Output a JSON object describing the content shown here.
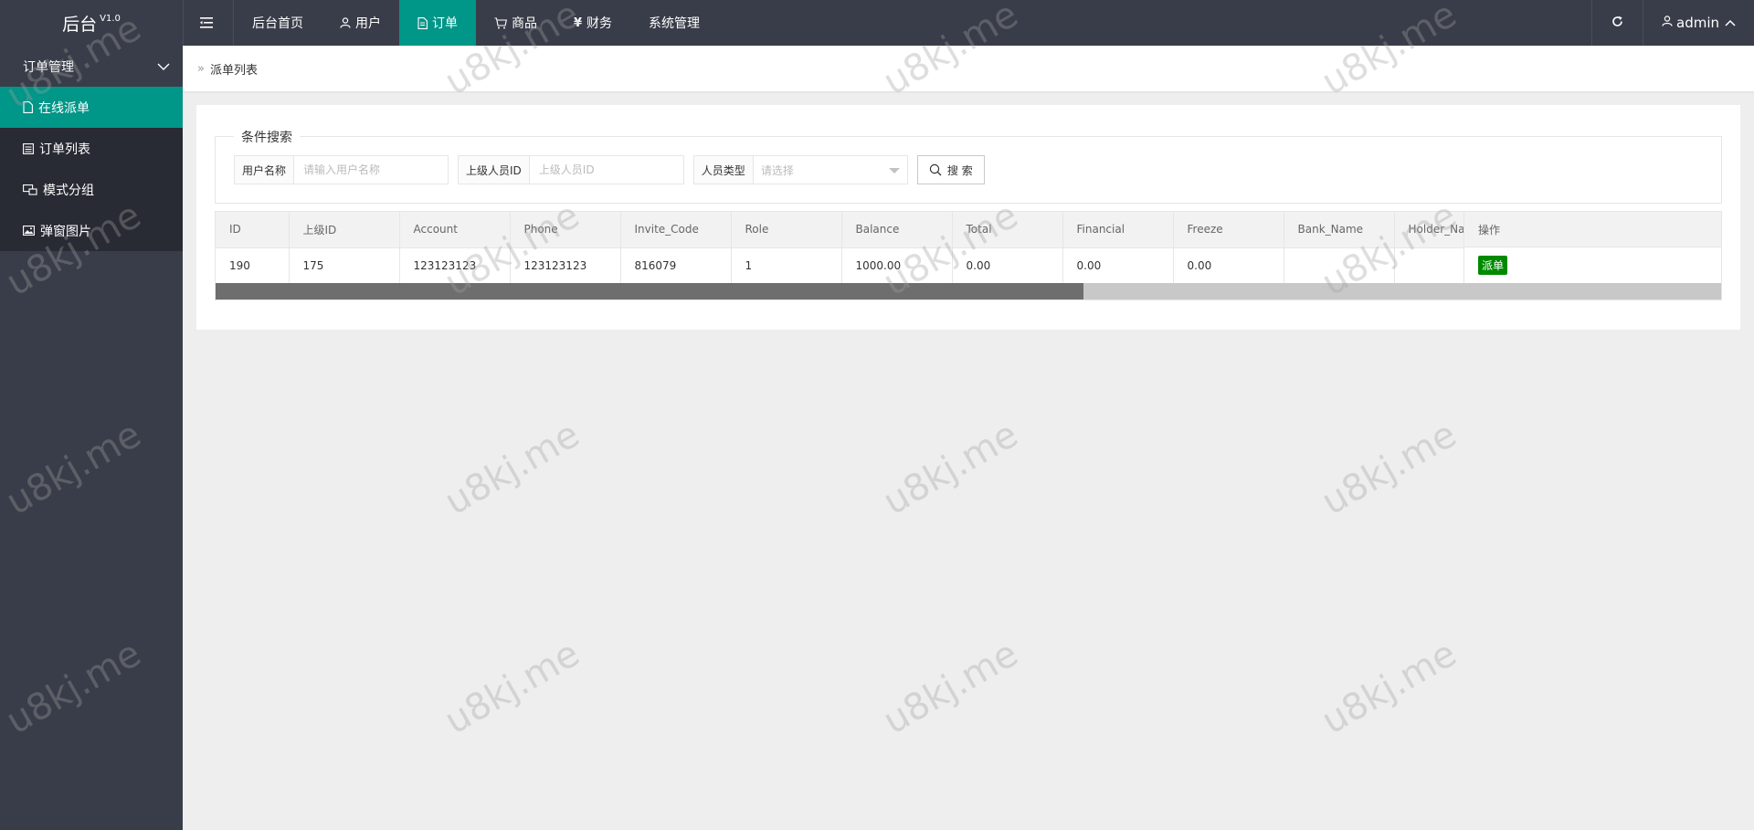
{
  "app": {
    "title": "后台",
    "version": "V1.0"
  },
  "topnav": {
    "items": [
      {
        "label": "后台首页",
        "icon": ""
      },
      {
        "label": "用户",
        "icon": "user-icon"
      },
      {
        "label": "订单",
        "icon": "document-icon",
        "active": true
      },
      {
        "label": "商品",
        "icon": "cart-icon"
      },
      {
        "label": "财务",
        "icon": "yen-icon"
      },
      {
        "label": "系统管理",
        "icon": ""
      }
    ],
    "user": "admin"
  },
  "sidebar": {
    "group": "订单管理",
    "items": [
      {
        "label": "在线派单",
        "icon": "document-icon",
        "active": true
      },
      {
        "label": "订单列表",
        "icon": "list-icon"
      },
      {
        "label": "模式分组",
        "icon": "group-icon"
      },
      {
        "label": "弹窗图片",
        "icon": "image-icon"
      }
    ]
  },
  "breadcrumb": {
    "current": "派单列表"
  },
  "search": {
    "legend": "条件搜索",
    "username_label": "用户名称",
    "username_placeholder": "请输入用户名称",
    "parent_label": "上级人员ID",
    "parent_placeholder": "上级人员ID",
    "type_label": "人员类型",
    "type_placeholder": "请选择",
    "button": "搜 索"
  },
  "table": {
    "columns": [
      "ID",
      "上级ID",
      "Account",
      "Phone",
      "Invite_Code",
      "Role",
      "Balance",
      "Total",
      "Financial",
      "Freeze",
      "Bank_Name",
      "Holder_Name"
    ],
    "op_header": "操作",
    "rows": [
      {
        "cells": [
          "190",
          "175",
          "123123123",
          "123123123",
          "816079",
          "1",
          "1000.00",
          "0.00",
          "0.00",
          "0.00",
          "",
          ""
        ],
        "action": "派单"
      }
    ]
  },
  "watermark": "u8kj.me",
  "colors": {
    "accent": "#009688",
    "header": "#393d49",
    "action": "#008a00"
  }
}
